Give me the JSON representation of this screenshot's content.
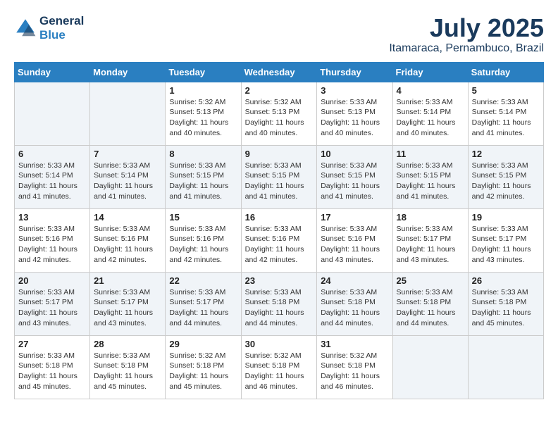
{
  "header": {
    "logo_line1": "General",
    "logo_line2": "Blue",
    "month": "July 2025",
    "location": "Itamaraca, Pernambuco, Brazil"
  },
  "days_of_week": [
    "Sunday",
    "Monday",
    "Tuesday",
    "Wednesday",
    "Thursday",
    "Friday",
    "Saturday"
  ],
  "weeks": [
    [
      {
        "day": "",
        "info": ""
      },
      {
        "day": "",
        "info": ""
      },
      {
        "day": "1",
        "info": "Sunrise: 5:32 AM\nSunset: 5:13 PM\nDaylight: 11 hours and 40 minutes."
      },
      {
        "day": "2",
        "info": "Sunrise: 5:32 AM\nSunset: 5:13 PM\nDaylight: 11 hours and 40 minutes."
      },
      {
        "day": "3",
        "info": "Sunrise: 5:33 AM\nSunset: 5:13 PM\nDaylight: 11 hours and 40 minutes."
      },
      {
        "day": "4",
        "info": "Sunrise: 5:33 AM\nSunset: 5:14 PM\nDaylight: 11 hours and 40 minutes."
      },
      {
        "day": "5",
        "info": "Sunrise: 5:33 AM\nSunset: 5:14 PM\nDaylight: 11 hours and 41 minutes."
      }
    ],
    [
      {
        "day": "6",
        "info": "Sunrise: 5:33 AM\nSunset: 5:14 PM\nDaylight: 11 hours and 41 minutes."
      },
      {
        "day": "7",
        "info": "Sunrise: 5:33 AM\nSunset: 5:14 PM\nDaylight: 11 hours and 41 minutes."
      },
      {
        "day": "8",
        "info": "Sunrise: 5:33 AM\nSunset: 5:15 PM\nDaylight: 11 hours and 41 minutes."
      },
      {
        "day": "9",
        "info": "Sunrise: 5:33 AM\nSunset: 5:15 PM\nDaylight: 11 hours and 41 minutes."
      },
      {
        "day": "10",
        "info": "Sunrise: 5:33 AM\nSunset: 5:15 PM\nDaylight: 11 hours and 41 minutes."
      },
      {
        "day": "11",
        "info": "Sunrise: 5:33 AM\nSunset: 5:15 PM\nDaylight: 11 hours and 41 minutes."
      },
      {
        "day": "12",
        "info": "Sunrise: 5:33 AM\nSunset: 5:15 PM\nDaylight: 11 hours and 42 minutes."
      }
    ],
    [
      {
        "day": "13",
        "info": "Sunrise: 5:33 AM\nSunset: 5:16 PM\nDaylight: 11 hours and 42 minutes."
      },
      {
        "day": "14",
        "info": "Sunrise: 5:33 AM\nSunset: 5:16 PM\nDaylight: 11 hours and 42 minutes."
      },
      {
        "day": "15",
        "info": "Sunrise: 5:33 AM\nSunset: 5:16 PM\nDaylight: 11 hours and 42 minutes."
      },
      {
        "day": "16",
        "info": "Sunrise: 5:33 AM\nSunset: 5:16 PM\nDaylight: 11 hours and 42 minutes."
      },
      {
        "day": "17",
        "info": "Sunrise: 5:33 AM\nSunset: 5:16 PM\nDaylight: 11 hours and 43 minutes."
      },
      {
        "day": "18",
        "info": "Sunrise: 5:33 AM\nSunset: 5:17 PM\nDaylight: 11 hours and 43 minutes."
      },
      {
        "day": "19",
        "info": "Sunrise: 5:33 AM\nSunset: 5:17 PM\nDaylight: 11 hours and 43 minutes."
      }
    ],
    [
      {
        "day": "20",
        "info": "Sunrise: 5:33 AM\nSunset: 5:17 PM\nDaylight: 11 hours and 43 minutes."
      },
      {
        "day": "21",
        "info": "Sunrise: 5:33 AM\nSunset: 5:17 PM\nDaylight: 11 hours and 43 minutes."
      },
      {
        "day": "22",
        "info": "Sunrise: 5:33 AM\nSunset: 5:17 PM\nDaylight: 11 hours and 44 minutes."
      },
      {
        "day": "23",
        "info": "Sunrise: 5:33 AM\nSunset: 5:18 PM\nDaylight: 11 hours and 44 minutes."
      },
      {
        "day": "24",
        "info": "Sunrise: 5:33 AM\nSunset: 5:18 PM\nDaylight: 11 hours and 44 minutes."
      },
      {
        "day": "25",
        "info": "Sunrise: 5:33 AM\nSunset: 5:18 PM\nDaylight: 11 hours and 44 minutes."
      },
      {
        "day": "26",
        "info": "Sunrise: 5:33 AM\nSunset: 5:18 PM\nDaylight: 11 hours and 45 minutes."
      }
    ],
    [
      {
        "day": "27",
        "info": "Sunrise: 5:33 AM\nSunset: 5:18 PM\nDaylight: 11 hours and 45 minutes."
      },
      {
        "day": "28",
        "info": "Sunrise: 5:33 AM\nSunset: 5:18 PM\nDaylight: 11 hours and 45 minutes."
      },
      {
        "day": "29",
        "info": "Sunrise: 5:32 AM\nSunset: 5:18 PM\nDaylight: 11 hours and 45 minutes."
      },
      {
        "day": "30",
        "info": "Sunrise: 5:32 AM\nSunset: 5:18 PM\nDaylight: 11 hours and 46 minutes."
      },
      {
        "day": "31",
        "info": "Sunrise: 5:32 AM\nSunset: 5:18 PM\nDaylight: 11 hours and 46 minutes."
      },
      {
        "day": "",
        "info": ""
      },
      {
        "day": "",
        "info": ""
      }
    ]
  ]
}
